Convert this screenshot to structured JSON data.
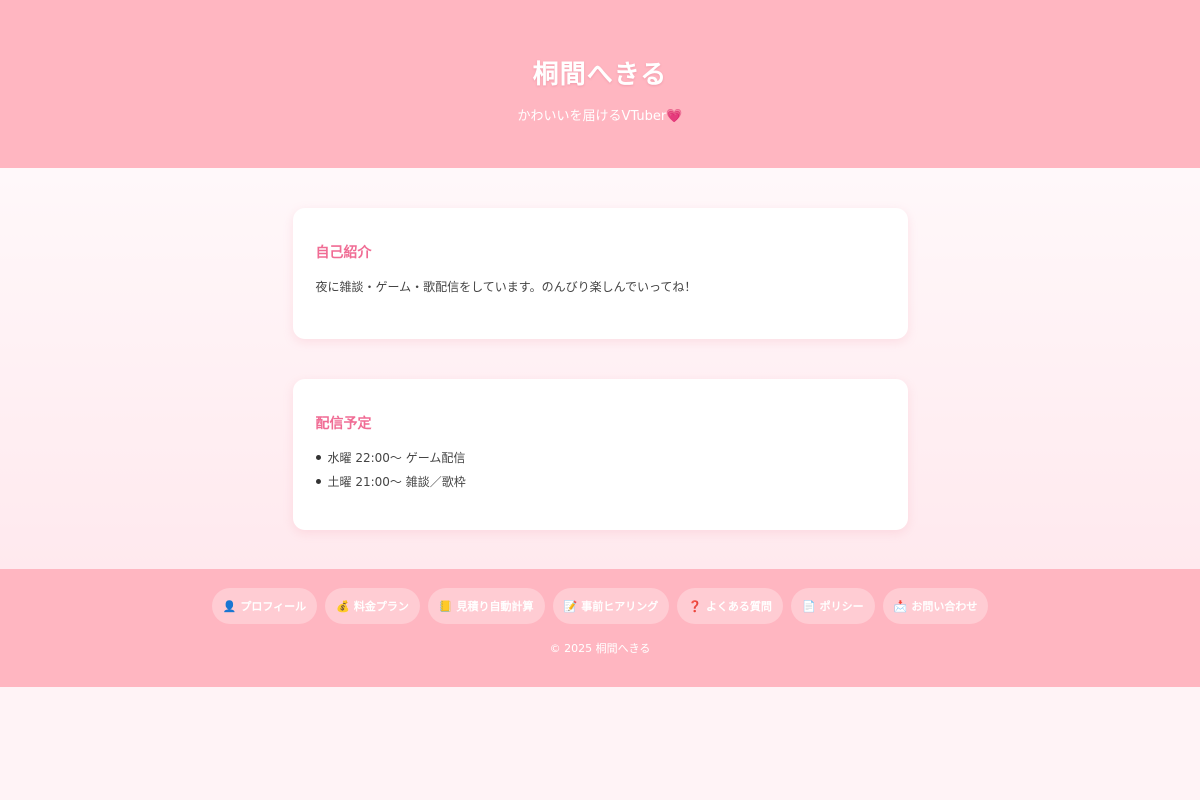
{
  "header": {
    "title": "桐間へきる",
    "tagline": "かわいいを届けるVTuber",
    "tagline_icon": "💗"
  },
  "intro": {
    "heading": "自己紹介",
    "text": "夜に雑談・ゲーム・歌配信をしています。のんびり楽しんでいってね！"
  },
  "schedule": {
    "heading": "配信予定",
    "items": [
      "水曜 22:00〜 ゲーム配信",
      "土曜 21:00〜 雑談／歌枠"
    ]
  },
  "nav": [
    {
      "icon": "👤",
      "label": "プロフィール"
    },
    {
      "icon": "💰",
      "label": "料金プラン"
    },
    {
      "icon": "📒",
      "label": "見積り自動計算"
    },
    {
      "icon": "📝",
      "label": "事前ヒアリング"
    },
    {
      "icon": "❓",
      "label": "よくある質問"
    },
    {
      "icon": "📄",
      "label": "ポリシー"
    },
    {
      "icon": "📩",
      "label": "お問い合わせ"
    }
  ],
  "footer": {
    "copyright": "© 2025 桐間へきる"
  },
  "colors": {
    "accent": "#ffb6c1",
    "heading": "#f06c94"
  }
}
